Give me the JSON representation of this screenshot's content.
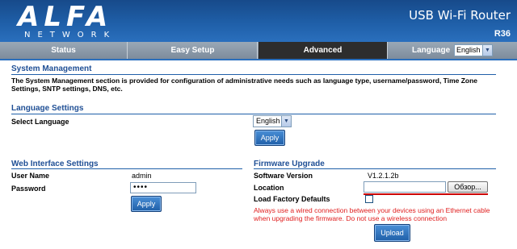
{
  "header": {
    "logo_main": "ALFA",
    "logo_sub": "NETWORK",
    "product": "USB Wi-Fi Router",
    "model": "R36"
  },
  "nav": {
    "tabs": [
      {
        "label": "Status"
      },
      {
        "label": "Easy Setup"
      },
      {
        "label": "Advanced"
      }
    ],
    "active_tab": "Advanced",
    "language_label": "Language",
    "language_value": "English"
  },
  "system": {
    "title": "System Management",
    "description": "The System Management section is provided for configuration of administrative needs such as language type, username/password, Time Zone Settings, SNTP settings, DNS, etc."
  },
  "language": {
    "title": "Language Settings",
    "label": "Select Language",
    "value": "English",
    "apply": "Apply"
  },
  "web": {
    "title": "Web Interface Settings",
    "user_label": "User Name",
    "user_value": "admin",
    "password_label": "Password",
    "password_value": "••••",
    "apply": "Apply"
  },
  "firmware": {
    "title": "Firmware Upgrade",
    "version_label": "Software Version",
    "version_value": "V1.2.1.2b",
    "location_label": "Location",
    "location_value": "",
    "browse": "Обзор...",
    "factory_label": "Load Factory Defaults",
    "warning": "Always use a wired connection between your devices using an Ethernet cable when upgrading the firmware. Do not use a wireless connection",
    "upload": "Upload"
  },
  "colors": {
    "header": "#1f5fa8",
    "section_title": "#1f4f95",
    "warning": "#e02020"
  }
}
